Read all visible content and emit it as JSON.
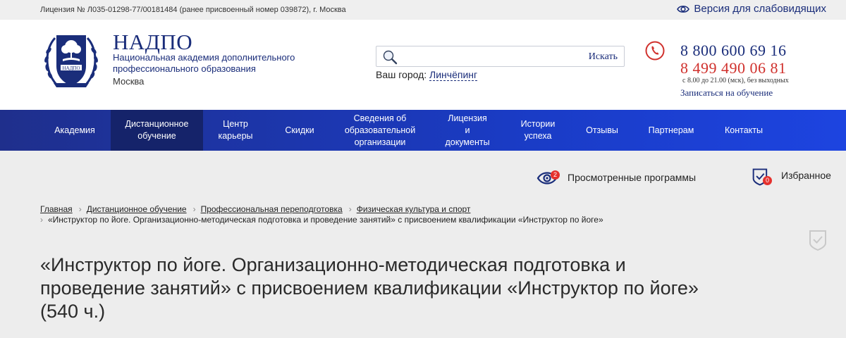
{
  "topbar": {
    "license": "Лицензия № Л035-01298-77/00181484 (ранее присвоенный номер 039872), г. Москва",
    "vision_label": "Версия для слабовидящих"
  },
  "brand": {
    "name": "НАДПО",
    "subtitle_line1": "Национальная академия дополнительного",
    "subtitle_line2": "профессионального образования",
    "city": "Москва",
    "emblem_text": "НАДПО"
  },
  "search": {
    "value": "",
    "placeholder": "",
    "button_label": "Искать"
  },
  "city": {
    "label": "Ваш город:",
    "value": "Линчёпинг"
  },
  "contacts": {
    "phone1": "8 800 600 69 16",
    "phone2": "8 499 490 06 81",
    "hours": "с 8.00 до 21.00 (мск), без выходных",
    "enroll_label": "Записаться на обучение"
  },
  "nav": {
    "items": [
      {
        "label": "Академия"
      },
      {
        "label": "Дистанционное обучение"
      },
      {
        "label": "Центр карьеры"
      },
      {
        "label": "Скидки"
      },
      {
        "label": "Сведения об образовательной организации"
      },
      {
        "label": "Лицензия и документы"
      },
      {
        "label": "Истории успеха"
      },
      {
        "label": "Отзывы"
      },
      {
        "label": "Партнерам"
      },
      {
        "label": "Контакты"
      }
    ],
    "active_index": 1
  },
  "utility": {
    "viewed_label": "Просмотренные программы",
    "viewed_count": "2",
    "favorites_label": "Избранное",
    "favorites_count": "0"
  },
  "breadcrumb": {
    "items": [
      "Главная",
      "Дистанционное обучение",
      "Профессиональная переподготовка",
      "Физическая культура и спорт"
    ],
    "current": "«Инструктор по йоге. Организационно-методическая подготовка и проведение занятий» с присвоением квалификации «Инструктор по йоге»"
  },
  "page": {
    "title": "«Инструктор по йоге. Организационно-методическая подготовка и проведение занятий» с присвоением квалификации «Инструктор по йоге» (540 ч.)"
  },
  "colors": {
    "brand_blue": "#1a2d7a",
    "accent_red": "#d0312d",
    "nav_active": "#15236a",
    "content_bg": "#ededed"
  },
  "icons": [
    "eye-icon",
    "emblem-icon",
    "search-icon",
    "phone-icon",
    "viewed-eye-icon",
    "favorites-icon",
    "chevron-right-icon",
    "bookmark-check-icon"
  ]
}
